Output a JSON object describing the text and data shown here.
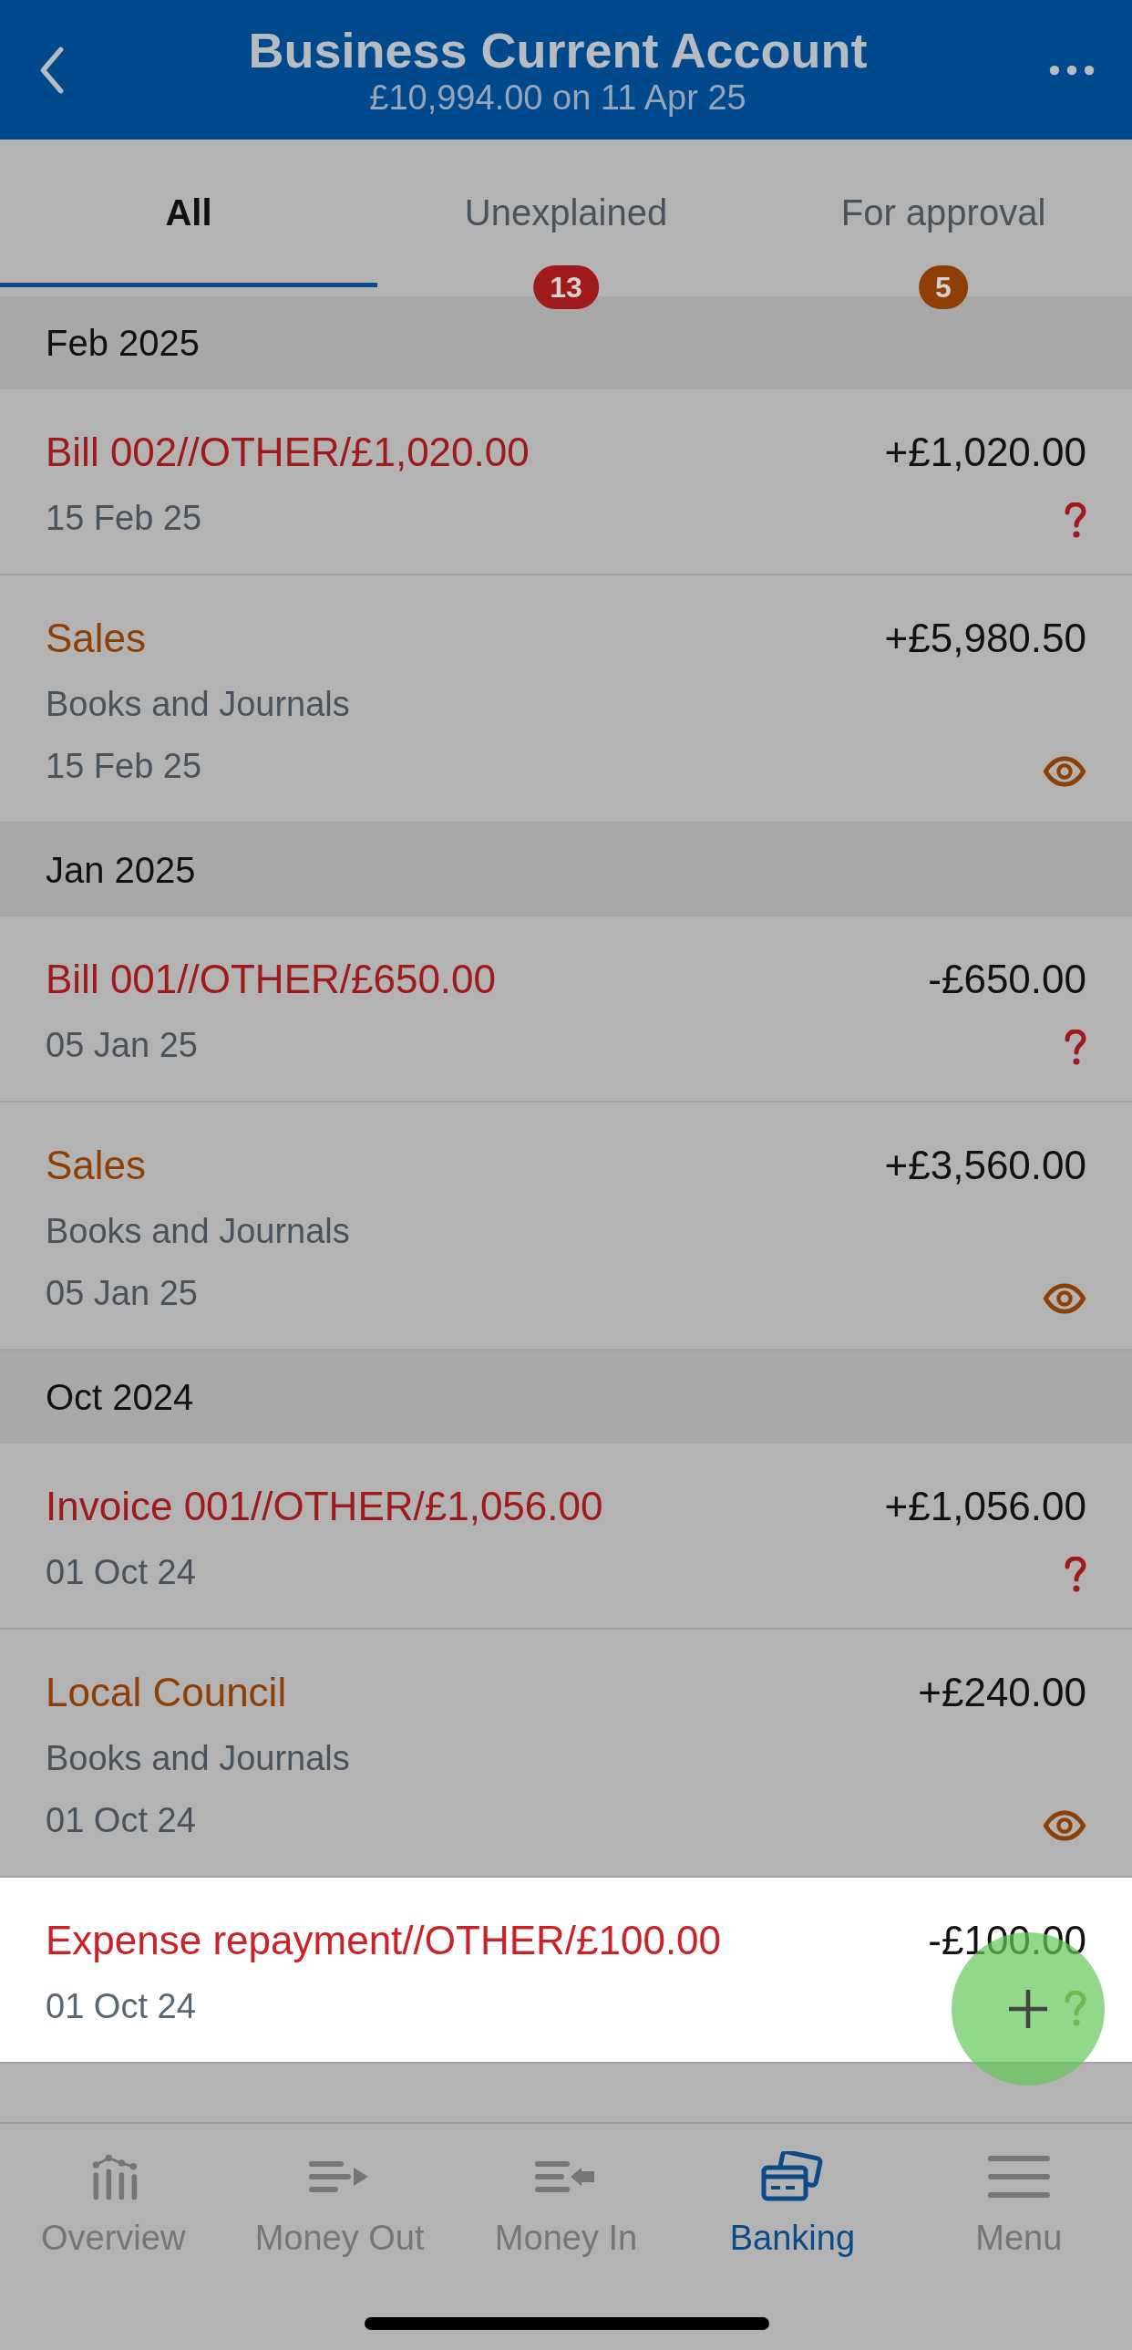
{
  "header": {
    "title": "Business Current Account",
    "subtitle": "£10,994.00 on 11 Apr 25"
  },
  "tabs": [
    {
      "label": "All",
      "selected": true
    },
    {
      "label": "Unexplained",
      "selected": false,
      "badge": "13",
      "color": "#a01a1c"
    },
    {
      "label": "For approval",
      "selected": false,
      "badge": "5",
      "color": "#8e3f06"
    }
  ],
  "groups": [
    {
      "month": "Feb 2025",
      "rows": [
        {
          "kind": "unexplained",
          "title": "Bill 002//OTHER/£1,020.00",
          "amount": "+£1,020.00",
          "date": "15 Feb 25",
          "highlighted": false
        },
        {
          "kind": "for_approval",
          "title": "Sales",
          "category": "Books and Journals",
          "amount": "+£5,980.50",
          "date": "15 Feb 25",
          "highlighted": false
        }
      ]
    },
    {
      "month": "Jan 2025",
      "rows": [
        {
          "kind": "unexplained",
          "title": "Bill 001//OTHER/£650.00",
          "amount": "-£650.00",
          "date": "05 Jan 25",
          "highlighted": false
        },
        {
          "kind": "for_approval",
          "title": "Sales",
          "category": "Books and Journals",
          "amount": "+£3,560.00",
          "date": "05 Jan 25",
          "highlighted": false
        }
      ]
    },
    {
      "month": "Oct 2024",
      "rows": [
        {
          "kind": "unexplained",
          "title": "Invoice 001//OTHER/£1,056.00",
          "amount": "+£1,056.00",
          "date": "01 Oct 24",
          "highlighted": false
        },
        {
          "kind": "for_approval",
          "title": "Local Council",
          "category": "Books and Journals",
          "amount": "+£240.00",
          "date": "01 Oct 24",
          "highlighted": false
        },
        {
          "kind": "unexplained",
          "title": "Expense repayment//OTHER/£100.00",
          "amount": "-£100.00",
          "date": "01 Oct 24",
          "highlighted": true
        }
      ]
    }
  ],
  "nav": [
    {
      "kind": "overview",
      "label": "Overview",
      "selected": false
    },
    {
      "kind": "money_out",
      "label": "Money Out",
      "selected": false
    },
    {
      "kind": "money_in",
      "label": "Money In",
      "selected": false
    },
    {
      "kind": "banking",
      "label": "Banking",
      "selected": true
    },
    {
      "kind": "menu",
      "label": "Menu",
      "selected": false
    }
  ]
}
